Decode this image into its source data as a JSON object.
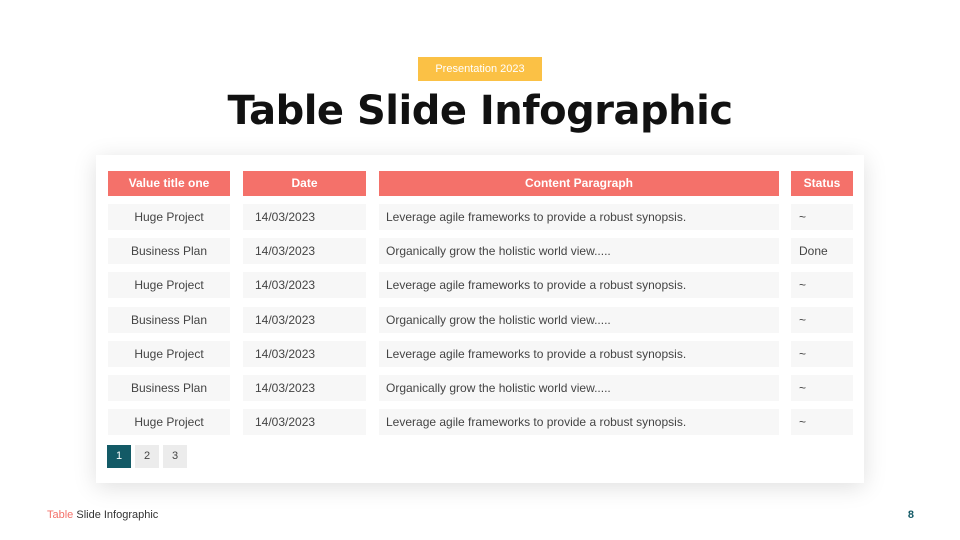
{
  "header": {
    "tag": "Presentation 2023",
    "title": "Table Slide Infographic"
  },
  "table": {
    "columns": [
      "Value title one",
      "Date",
      "Content Paragraph",
      "Status"
    ],
    "rows": [
      [
        "Huge Project",
        "14/03/2023",
        "Leverage agile frameworks to provide a robust synopsis.",
        "~"
      ],
      [
        "Business Plan",
        "14/03/2023",
        "Organically grow the holistic world view.....",
        "Done"
      ],
      [
        "Huge Project",
        "14/03/2023",
        "Leverage agile frameworks to provide a robust synopsis.",
        "~"
      ],
      [
        "Business Plan",
        "14/03/2023",
        "Organically grow the holistic world view.....",
        "~"
      ],
      [
        "Huge Project",
        "14/03/2023",
        "Leverage agile frameworks to provide a robust synopsis.",
        "~"
      ],
      [
        "Business Plan",
        "14/03/2023",
        "Organically grow the holistic world view.....",
        "~"
      ],
      [
        "Huge Project",
        "14/03/2023",
        "Leverage agile frameworks to provide a robust synopsis.",
        "~"
      ]
    ]
  },
  "pagination": {
    "pages": [
      "1",
      "2",
      "3"
    ],
    "active": "1"
  },
  "footer": {
    "accent_text": "Table",
    "text": " Slide Infographic",
    "page_number": "8"
  },
  "colors": {
    "accent": "#f4716a",
    "tag": "#fbc145",
    "active_page": "#135a66"
  }
}
